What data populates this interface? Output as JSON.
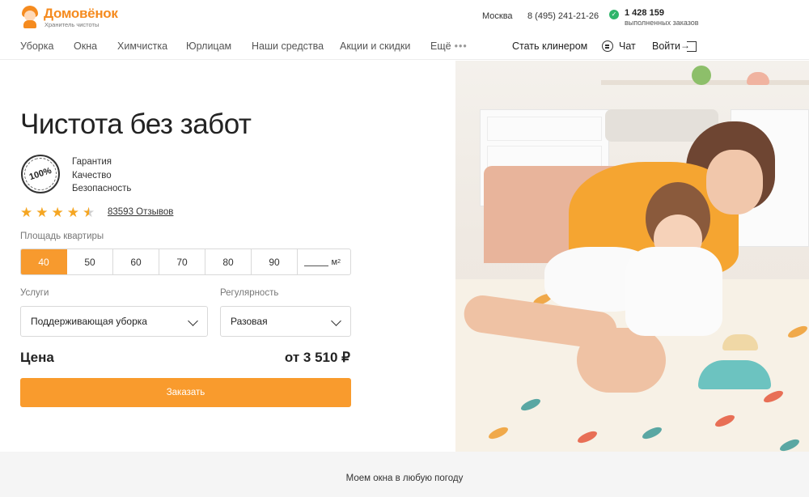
{
  "header": {
    "logo_name": "Домовёнок",
    "logo_tagline": "Хранитель чистоты",
    "city": "Москва",
    "phone": "8 (495) 241-21-26",
    "orders_count": "1 428 159",
    "orders_label": "выполненных заказов"
  },
  "nav": {
    "items": [
      "Уборка",
      "Окна",
      "Химчистка",
      "Юрлицам",
      "Наши средства",
      "Акции и скидки",
      "Ещё"
    ],
    "more_dots": "•••",
    "become_cleaner": "Стать клинером",
    "chat": "Чат",
    "login": "Войти"
  },
  "hero": {
    "title": "Чистота без забот",
    "badge": "100%",
    "perks": [
      "Гарантия",
      "Качество",
      "Безопасность"
    ],
    "rating": 4.5,
    "stars": [
      "★",
      "★",
      "★",
      "★",
      "★"
    ],
    "reviews": "83593 Отзывов"
  },
  "calculator": {
    "area_label": "Площадь квартиры",
    "area_options": [
      "40",
      "50",
      "60",
      "70",
      "80",
      "90"
    ],
    "area_selected": "40",
    "area_unit": "м",
    "area_unit_sup": "2",
    "services_label": "Услуги",
    "services_value": "Поддерживающая уборка",
    "regularity_label": "Регулярность",
    "regularity_value": "Разовая",
    "price_label": "Цена",
    "price_value": "от 3 510 ₽",
    "order_button": "Заказать"
  },
  "strip": {
    "text": "Моем окна в любую погоду"
  },
  "colors": {
    "accent": "#f79a2e",
    "star": "#f5a623",
    "success": "#2fb56a"
  }
}
